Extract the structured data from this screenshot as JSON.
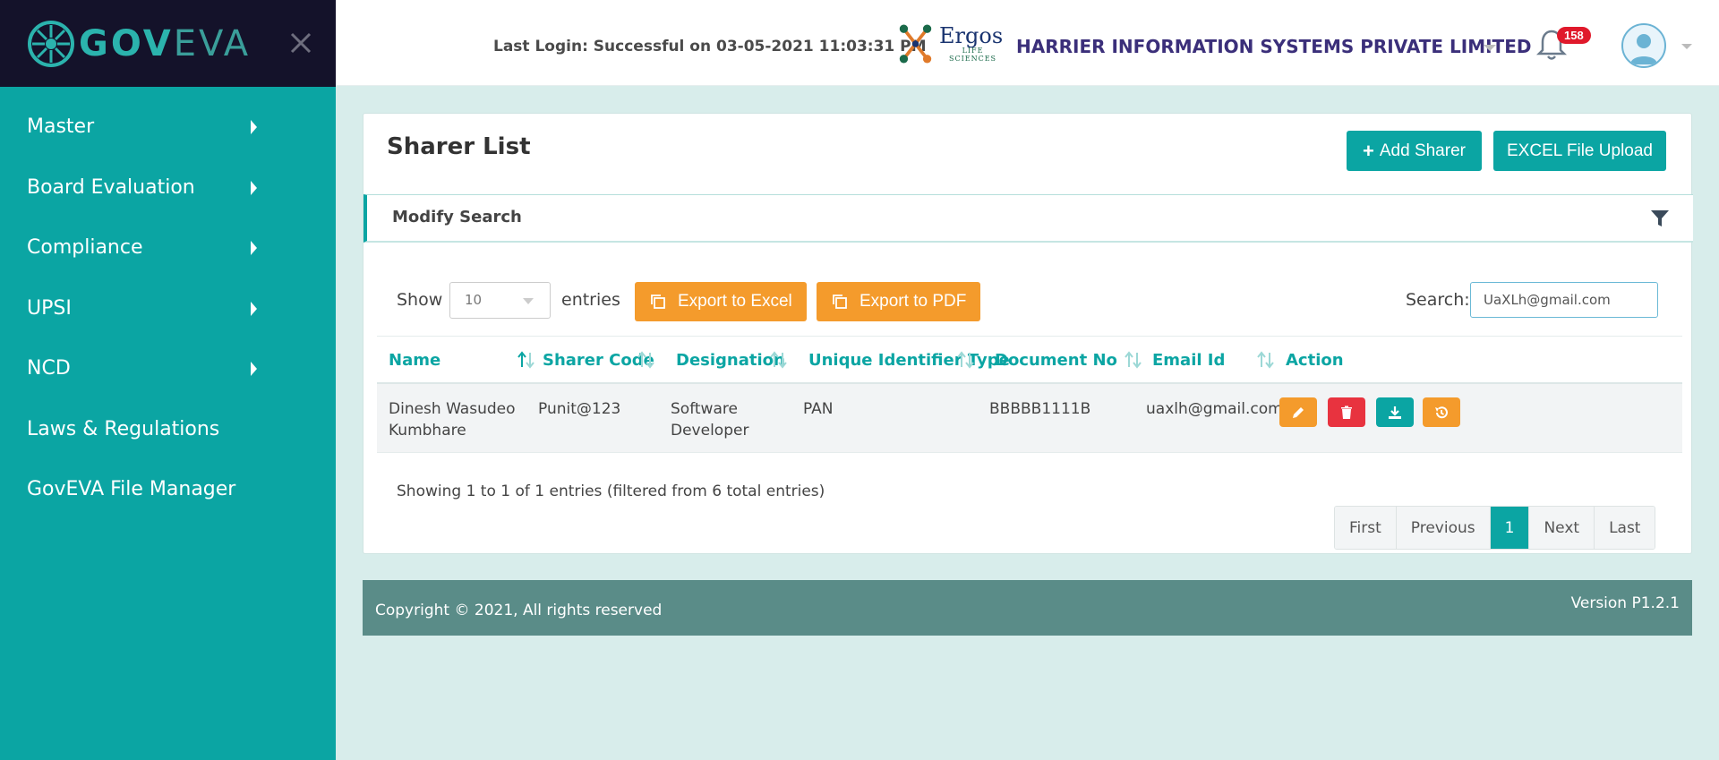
{
  "brand": {
    "name_part1": "GOV",
    "name_part2": "EVA"
  },
  "sidebar": {
    "items": [
      {
        "label": "Master",
        "has_submenu": true
      },
      {
        "label": "Board Evaluation",
        "has_submenu": true
      },
      {
        "label": "Compliance",
        "has_submenu": true
      },
      {
        "label": "UPSI",
        "has_submenu": true
      },
      {
        "label": "NCD",
        "has_submenu": true
      },
      {
        "label": "Laws & Regulations",
        "has_submenu": false
      },
      {
        "label": "GovEVA File Manager",
        "has_submenu": false
      }
    ]
  },
  "header": {
    "last_login": "Last Login: Successful on 03-05-2021 11:03:31 PM",
    "client_logo": {
      "name": "Ergos",
      "tagline": "LIFE SCIENCES"
    },
    "company": "HARRIER INFORMATION SYSTEMS PRIVATE LIMITED",
    "notification_count": "158"
  },
  "main": {
    "title": "Sharer List",
    "add_button": "Add Sharer",
    "upload_button": "EXCEL File Upload",
    "modify_search": "Modify Search",
    "show_label": "Show",
    "entries_value": "10",
    "entries_label": "entries",
    "export_excel": "Export to Excel",
    "export_pdf": "Export to PDF",
    "search_label": "Search:",
    "search_value": "UaXLh@gmail.com",
    "table": {
      "columns": [
        "Name",
        "Sharer Code",
        "Designation",
        "Unique Identifier Type",
        "Document No",
        "Email Id",
        "Action"
      ],
      "rows": [
        {
          "name_line1": "Dinesh Wasudeo",
          "name_line2": "Kumbhare",
          "sharer_code": "Punit@123",
          "designation_line1": "Software",
          "designation_line2": "Developer",
          "uid_type": "PAN",
          "document_no": "BBBBB1111B",
          "email": "uaxlh@gmail.com"
        }
      ]
    },
    "info": "Showing 1 to 1 of 1 entries (filtered from 6 total entries)",
    "pagination": [
      "First",
      "Previous",
      "1",
      "Next",
      "Last"
    ],
    "active_page": "1"
  },
  "footer": {
    "copyright": "Copyright © 2021, All rights reserved",
    "version": "Version P1.2.1"
  },
  "colors": {
    "primary": "#0ba5a3",
    "brand_dark": "#14122a",
    "orange": "#f49b2c",
    "danger": "#e8333f",
    "footer": "#5a8c88",
    "background": "#d8edeb"
  },
  "icons": [
    "logo-icon",
    "close-icon",
    "caret-right-icon",
    "bell-icon",
    "user-avatar-icon",
    "plus-icon",
    "filter-icon",
    "copy-icon",
    "sort-icon",
    "edit-icon",
    "delete-icon",
    "download-icon",
    "history-icon"
  ]
}
